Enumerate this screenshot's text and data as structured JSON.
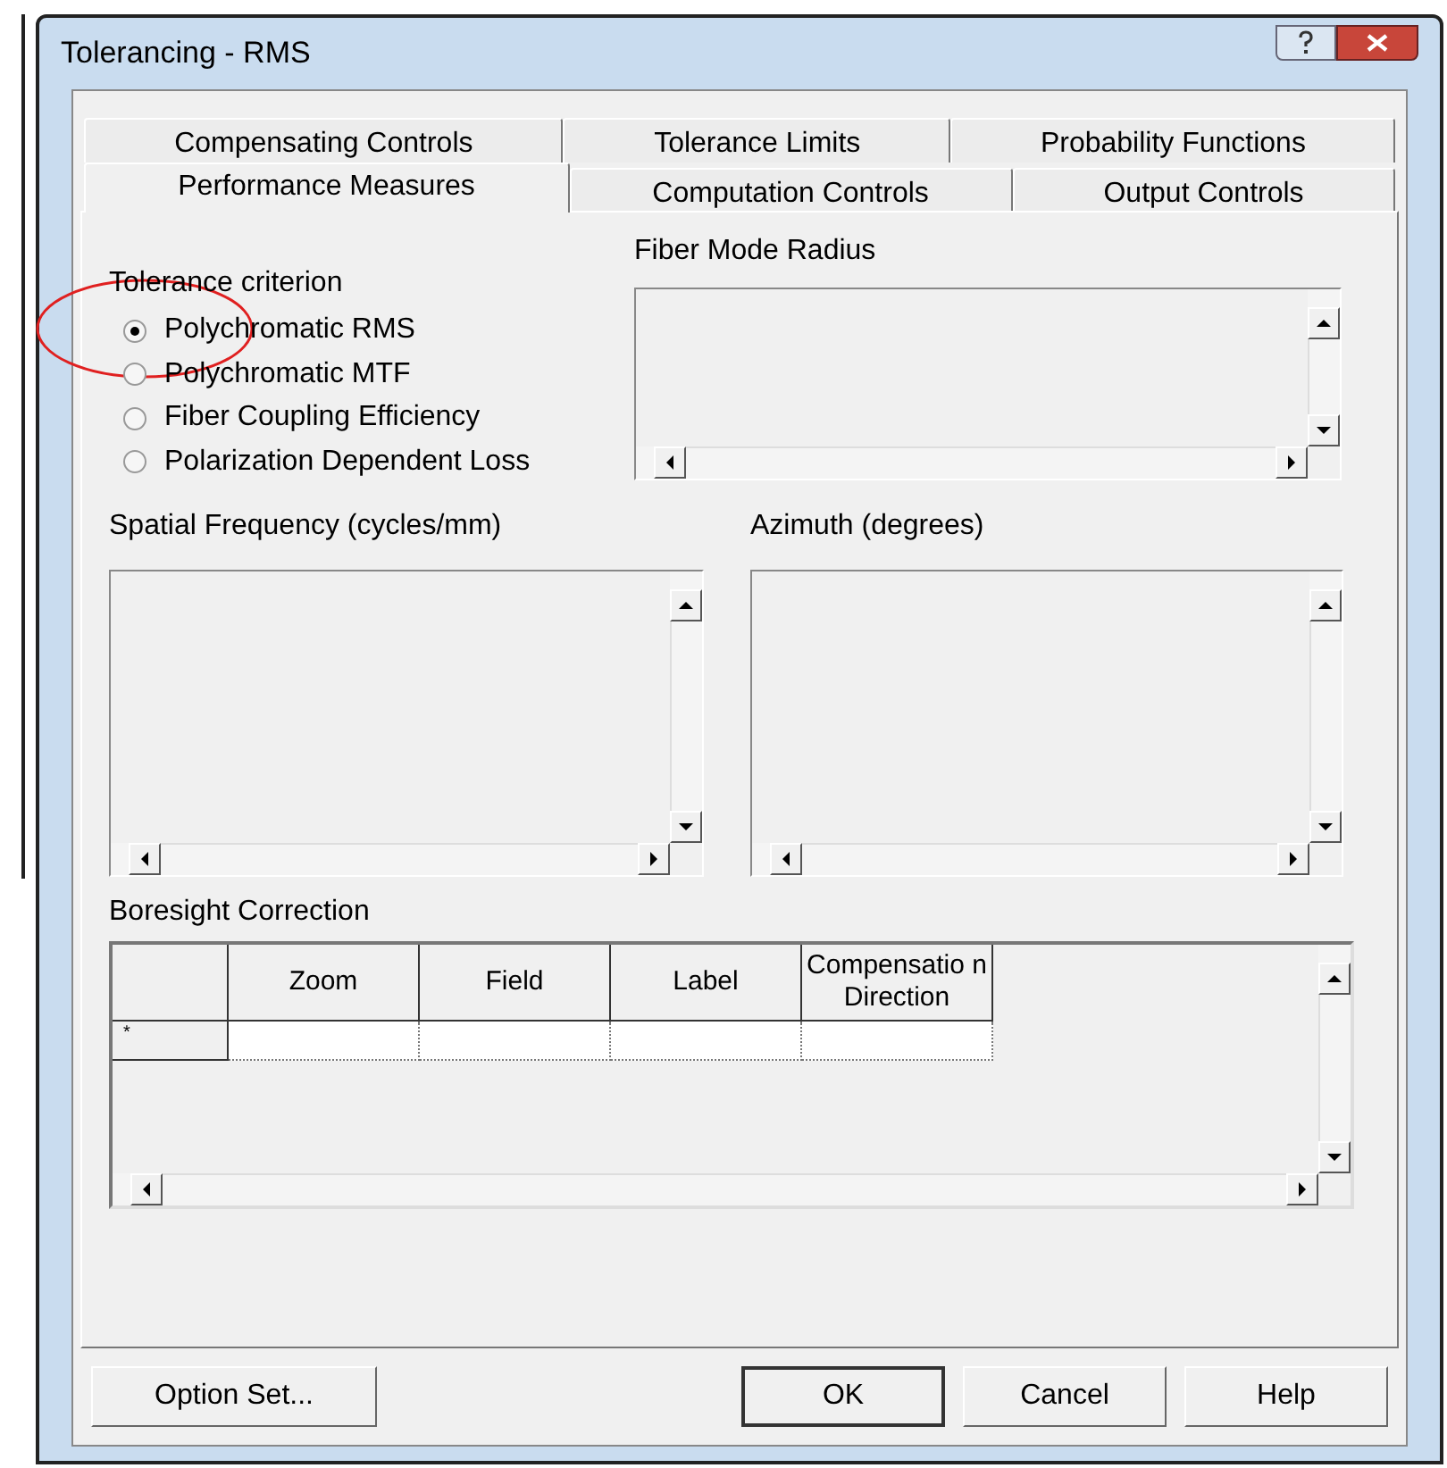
{
  "window": {
    "title": "Tolerancing - RMS"
  },
  "tab_rows": [
    {
      "tabs": [
        {
          "label": "Compensating Controls",
          "selected": false
        },
        {
          "label": "Tolerance Limits",
          "selected": false
        },
        {
          "label": "Probability Functions",
          "selected": false
        }
      ]
    },
    {
      "tabs": [
        {
          "label": "Performance Measures",
          "selected": true
        },
        {
          "label": "Computation Controls",
          "selected": false
        },
        {
          "label": "Output Controls",
          "selected": false
        }
      ]
    }
  ],
  "tolerance_criterion": {
    "label": "Tolerance criterion",
    "options": [
      {
        "label": "Polychromatic RMS",
        "selected": true
      },
      {
        "label": "Polychromatic MTF",
        "selected": false
      },
      {
        "label": "Fiber Coupling Efficiency",
        "selected": false
      },
      {
        "label": "Polarization Dependent Loss",
        "selected": false
      }
    ]
  },
  "fiber_mode_radius": {
    "label": "Fiber Mode Radius"
  },
  "spatial_frequency": {
    "label": "Spatial Frequency (cycles/mm)"
  },
  "azimuth": {
    "label": "Azimuth (degrees)"
  },
  "boresight_correction": {
    "label": "Boresight Correction",
    "columns": [
      "Zoom",
      "Field",
      "Label",
      "Compensatio n Direction"
    ],
    "rows": [
      {
        "marker": "*"
      }
    ]
  },
  "buttons": {
    "option_set": "Option Set...",
    "ok": "OK",
    "cancel": "Cancel",
    "help": "Help"
  }
}
